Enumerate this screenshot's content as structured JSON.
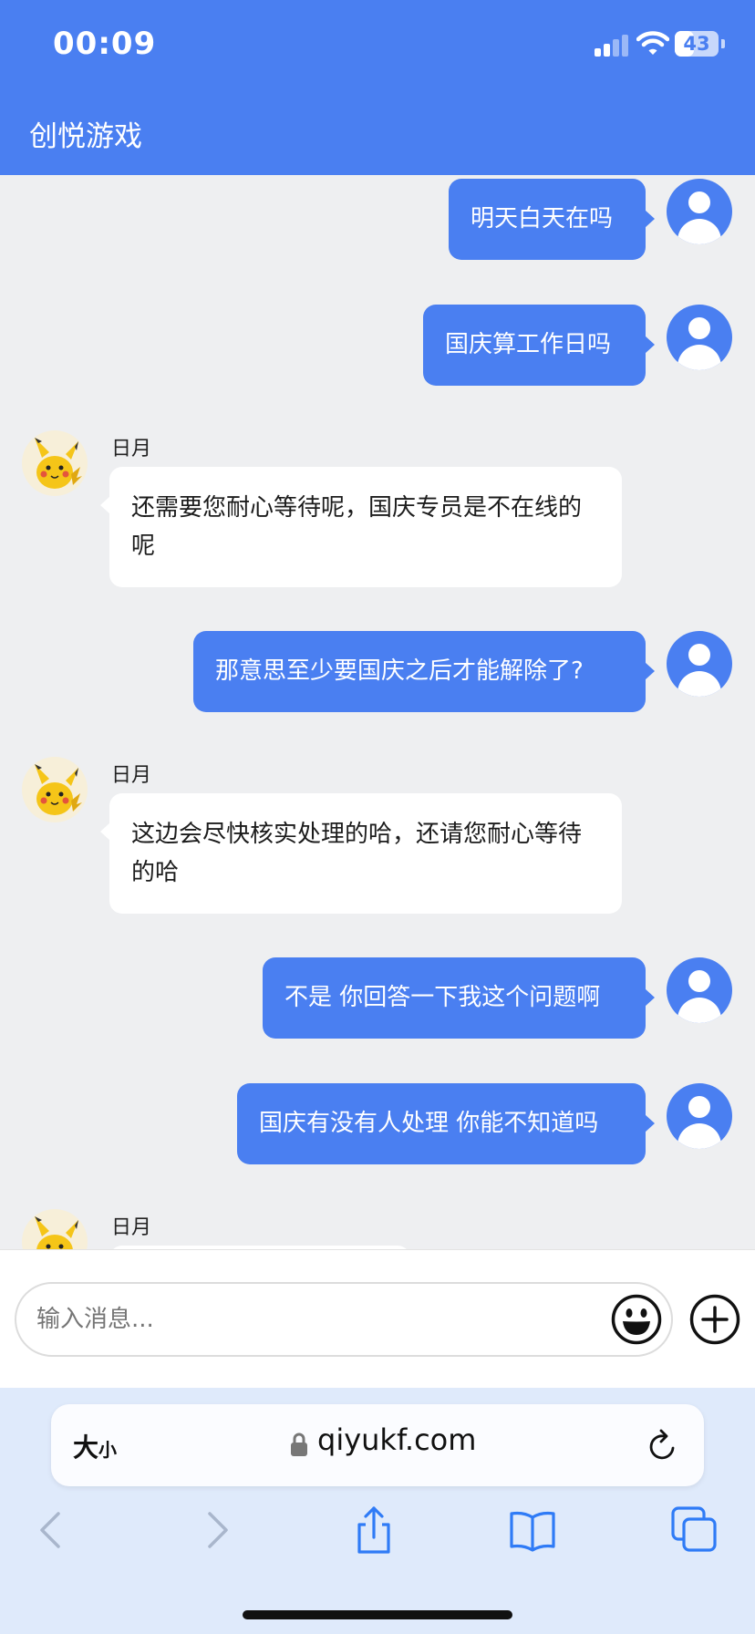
{
  "status_bar": {
    "time": "00:09",
    "battery": "43",
    "battery_level": 0.43
  },
  "header": {
    "title": "创悦游戏"
  },
  "messages": [
    {
      "from": "user",
      "text": "明天白天在吗"
    },
    {
      "from": "user",
      "text": "国庆算工作日吗"
    },
    {
      "from": "agent",
      "sender": "日月",
      "text": "还需要您耐心等待呢，国庆专员是不在线的呢"
    },
    {
      "from": "user",
      "text": "那意思至少要国庆之后才能解除了?"
    },
    {
      "from": "agent",
      "sender": "日月",
      "text": "这边会尽快核实处理的哈，还请您耐心等待的哈"
    },
    {
      "from": "user",
      "text": "不是 你回答一下我这个问题啊"
    },
    {
      "from": "user",
      "text": "国庆有没有人处理 你能不知道吗"
    },
    {
      "from": "agent",
      "sender": "日月",
      "text": ""
    }
  ],
  "input": {
    "placeholder": "输入消息..."
  },
  "browser": {
    "text_size_big": "大",
    "text_size_small": "小",
    "url": "qiyukf.com"
  },
  "colors": {
    "accent": "#4a7ff1",
    "chat_bg": "#eeeff1",
    "browser_bg": "#dfeafb"
  }
}
